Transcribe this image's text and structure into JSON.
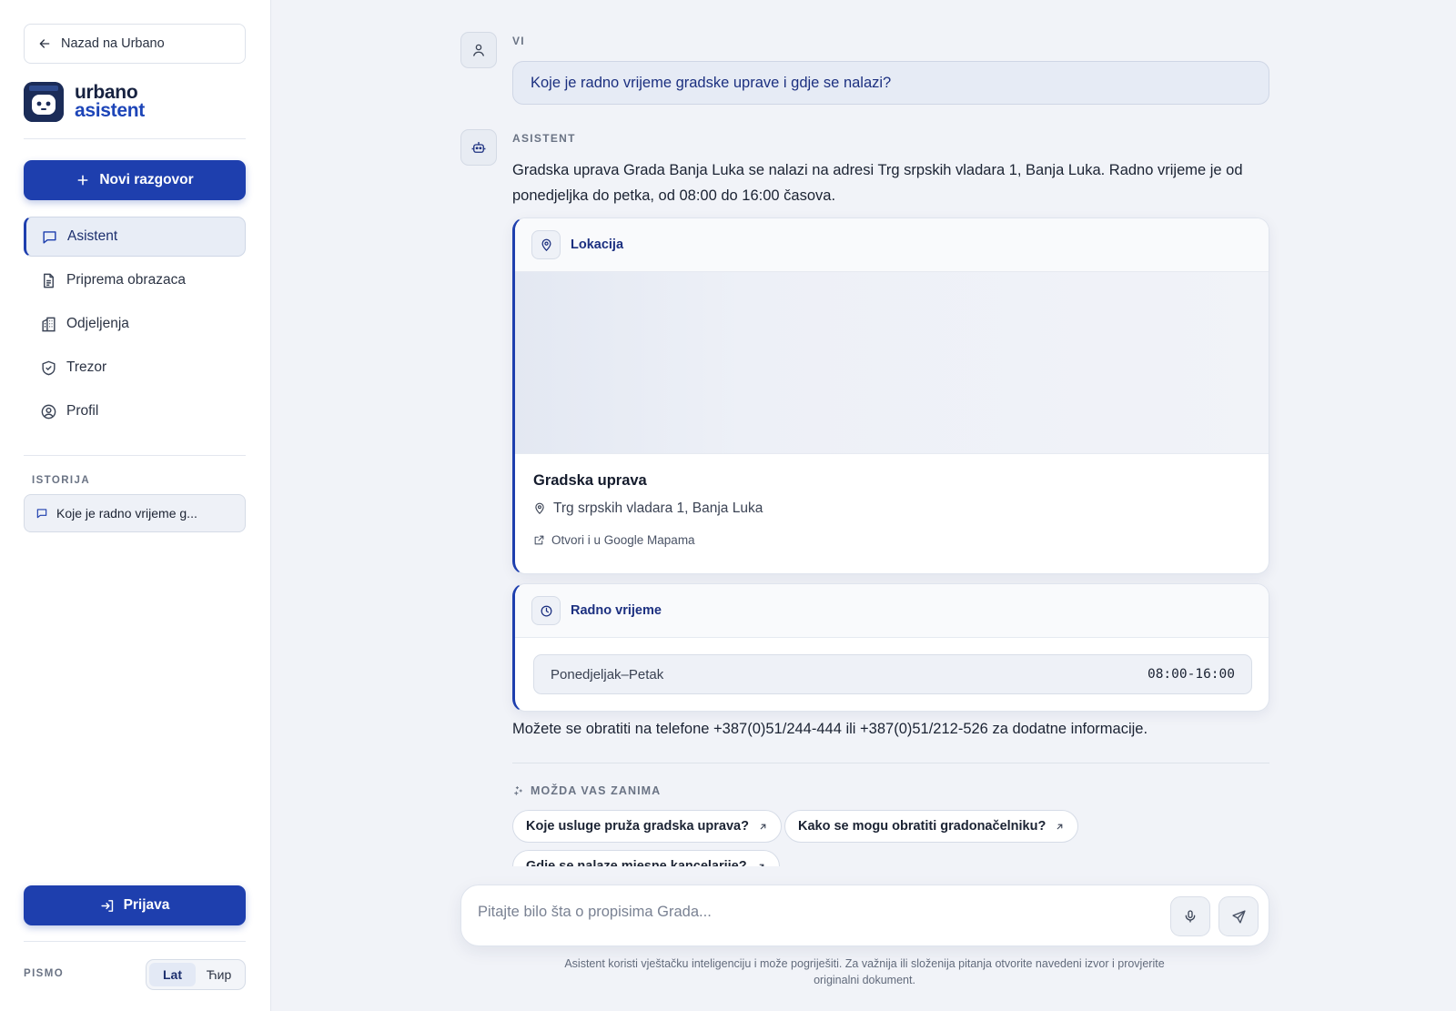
{
  "sidebar": {
    "back_label": "Nazad na Urbano",
    "logo_line1": "urbano",
    "logo_line2": "asistent",
    "new_chat_label": "Novi razgovor",
    "nav": [
      {
        "label": "Asistent",
        "icon": "chat-icon",
        "active": true
      },
      {
        "label": "Priprema obrazaca",
        "icon": "document-icon",
        "active": false
      },
      {
        "label": "Odjeljenja",
        "icon": "building-icon",
        "active": false
      },
      {
        "label": "Trezor",
        "icon": "shield-icon",
        "active": false
      },
      {
        "label": "Profil",
        "icon": "user-circle-icon",
        "active": false
      }
    ],
    "history_title": "ISTORIJA",
    "history_items": [
      {
        "label": "Koje je radno vrijeme g..."
      }
    ],
    "login_label": "Prijava",
    "script_label": "PISMO",
    "script_options": [
      "Lat",
      "Ћир"
    ],
    "script_selected": "Lat"
  },
  "conversation": {
    "user_role": "VI",
    "user_message": "Koje je radno vrijeme gradske uprave i gdje se nalazi?",
    "assistant_role": "ASISTENT",
    "assistant_answer": "Gradska uprava Grada Banja Luka se nalazi na adresi Trg srpskih vladara 1, Banja Luka. Radno vrijeme je od ponedjeljka do petka, od 08:00 do 16:00 časova.",
    "location_card": {
      "title": "Lokacija",
      "place_name": "Gradska uprava",
      "address": "Trg srpskih vladara 1, Banja Luka",
      "link_label": "Otvori i u Google Mapama"
    },
    "hours_card": {
      "title": "Radno vrijeme",
      "rows": [
        {
          "day": "Ponedjeljak–Petak",
          "time": "08:00-16:00"
        }
      ]
    },
    "contact_text": "Možete se obratiti na telefone +387(0)51/244-444 ili +387(0)51/212-526 za dodatne informacije.",
    "suggestions_title": "MOŽDA VAS ZANIMA",
    "suggestions": [
      "Koje usluge pruža gradska uprava?",
      "Kako se mogu obratiti gradonačelniku?",
      "Gdje se nalaze mjesne kancelarije?"
    ]
  },
  "composer": {
    "placeholder": "Pitajte bilo šta o propisima Grada...",
    "value": ""
  },
  "disclaimer": "Asistent koristi vještačku inteligenciju i može pogriješiti. Za važnija ili složenija pitanja otvorite navedeni izvor i provjerite originalni dokument.",
  "colors": {
    "accent": "#1e3fae",
    "sidebar_bg": "#ffffff",
    "main_bg": "#f1f3f8"
  }
}
